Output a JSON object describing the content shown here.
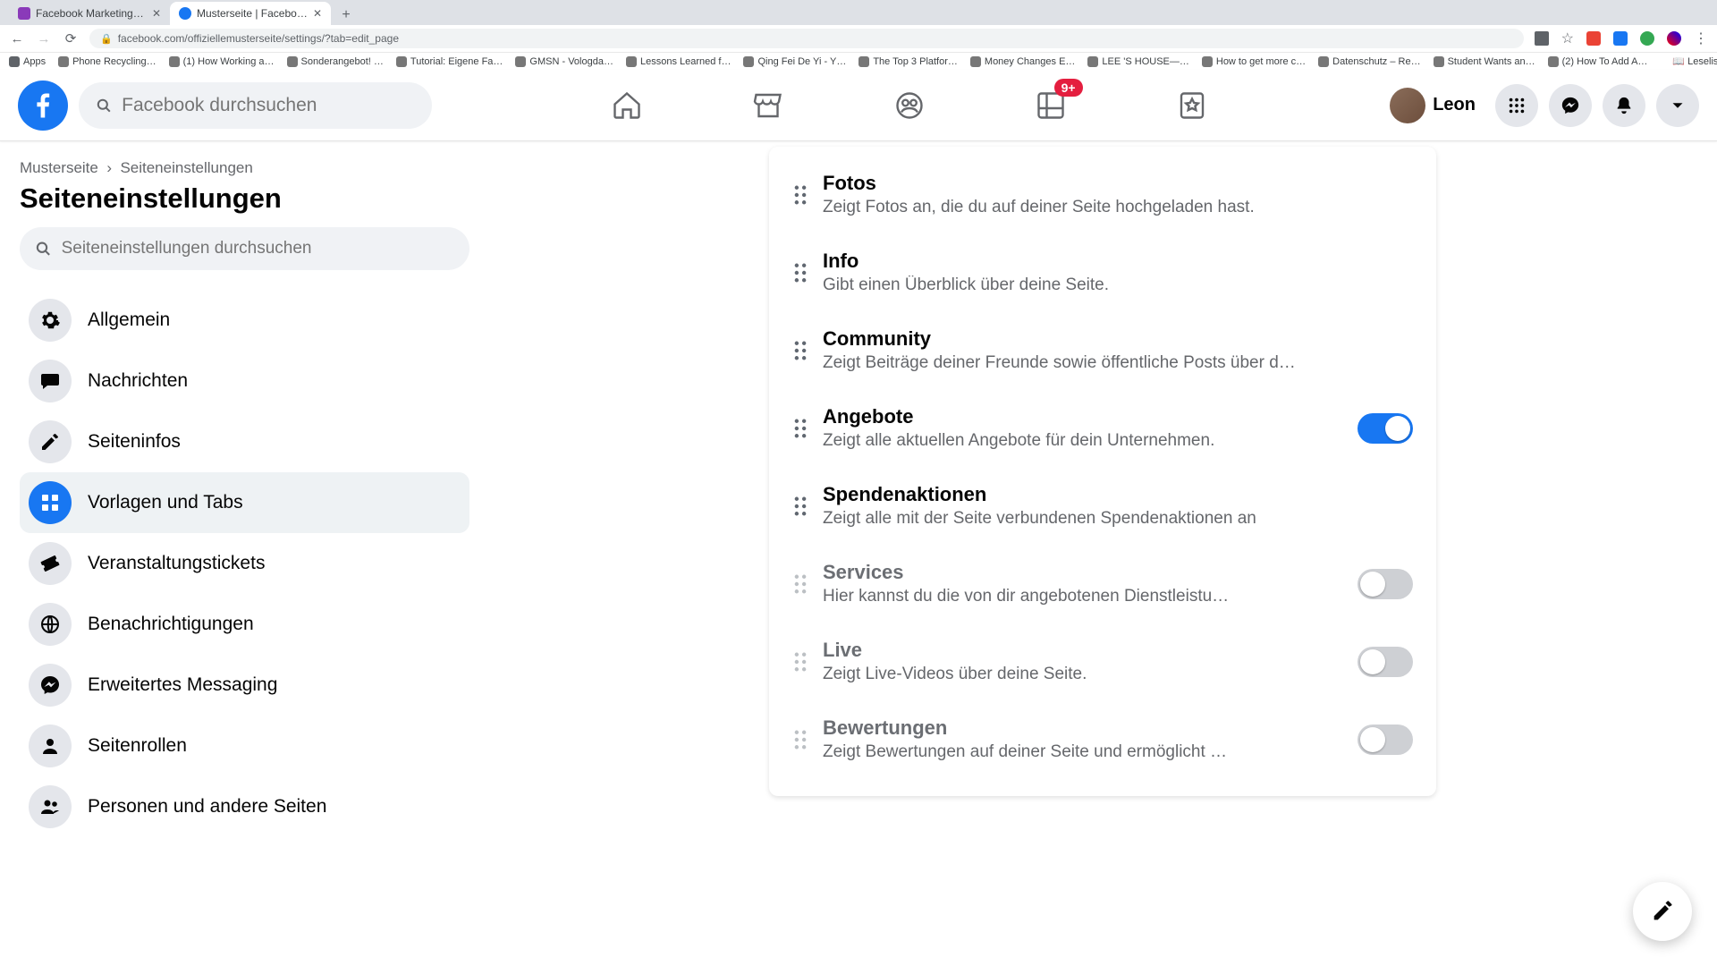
{
  "browser": {
    "tabs": [
      {
        "title": "Facebook Marketing & Werbe…",
        "active": false
      },
      {
        "title": "Musterseite | Facebook",
        "active": true
      }
    ],
    "url": "facebook.com/offiziellemusterseite/settings/?tab=edit_page",
    "bookmarks": [
      "Apps",
      "Phone Recycling…",
      "(1) How Working a…",
      "Sonderangebot! …",
      "Tutorial: Eigene Fa…",
      "GMSN - Vologda…",
      "Lessons Learned f…",
      "Qing Fei De Yi - Y…",
      "The Top 3 Platfor…",
      "Money Changes E…",
      "LEE 'S HOUSE—…",
      "How to get more c…",
      "Datenschutz – Re…",
      "Student Wants an…",
      "(2) How To Add A…"
    ],
    "reading_list": "Leseliste"
  },
  "header": {
    "search_placeholder": "Facebook durchsuchen",
    "badge": "9+",
    "profile_name": "Leon"
  },
  "breadcrumb": {
    "root": "Musterseite",
    "current": "Seiteneinstellungen"
  },
  "page_title": "Seiteneinstellungen",
  "side_search_placeholder": "Seiteneinstellungen durchsuchen",
  "menu": [
    {
      "key": "general",
      "label": "Allgemein",
      "icon": "gear"
    },
    {
      "key": "messages",
      "label": "Nachrichten",
      "icon": "chat"
    },
    {
      "key": "pageinfo",
      "label": "Seiteninfos",
      "icon": "pencil"
    },
    {
      "key": "templates",
      "label": "Vorlagen und Tabs",
      "icon": "grid",
      "active": true
    },
    {
      "key": "tickets",
      "label": "Veranstaltungstickets",
      "icon": "ticket"
    },
    {
      "key": "notifications",
      "label": "Benachrichtigungen",
      "icon": "globe"
    },
    {
      "key": "advmsg",
      "label": "Erweitertes Messaging",
      "icon": "messenger"
    },
    {
      "key": "roles",
      "label": "Seitenrollen",
      "icon": "person"
    },
    {
      "key": "people",
      "label": "Personen und andere Seiten",
      "icon": "people"
    }
  ],
  "tabs": [
    {
      "key": "fotos",
      "title": "Fotos",
      "desc": "Zeigt Fotos an, die du auf deiner Seite hochgeladen hast.",
      "toggle": null,
      "dim": false
    },
    {
      "key": "info",
      "title": "Info",
      "desc": "Gibt einen Überblick über deine Seite.",
      "toggle": null,
      "dim": false
    },
    {
      "key": "community",
      "title": "Community",
      "desc": "Zeigt Beiträge deiner Freunde sowie öffentliche Posts über d…",
      "toggle": null,
      "dim": false
    },
    {
      "key": "angebote",
      "title": "Angebote",
      "desc": "Zeigt alle aktuellen Angebote für dein Unternehmen.",
      "toggle": true,
      "dim": false
    },
    {
      "key": "spenden",
      "title": "Spendenaktionen",
      "desc": "Zeigt alle mit der Seite verbundenen Spendenaktionen an",
      "toggle": null,
      "dim": false
    },
    {
      "key": "services",
      "title": "Services",
      "desc": "Hier kannst du die von dir angebotenen Dienstleistu…",
      "toggle": false,
      "dim": true
    },
    {
      "key": "live",
      "title": "Live",
      "desc": "Zeigt Live-Videos über deine Seite.",
      "toggle": false,
      "dim": true
    },
    {
      "key": "bewertungen",
      "title": "Bewertungen",
      "desc": "Zeigt Bewertungen auf deiner Seite und ermöglicht …",
      "toggle": false,
      "dim": true
    }
  ]
}
